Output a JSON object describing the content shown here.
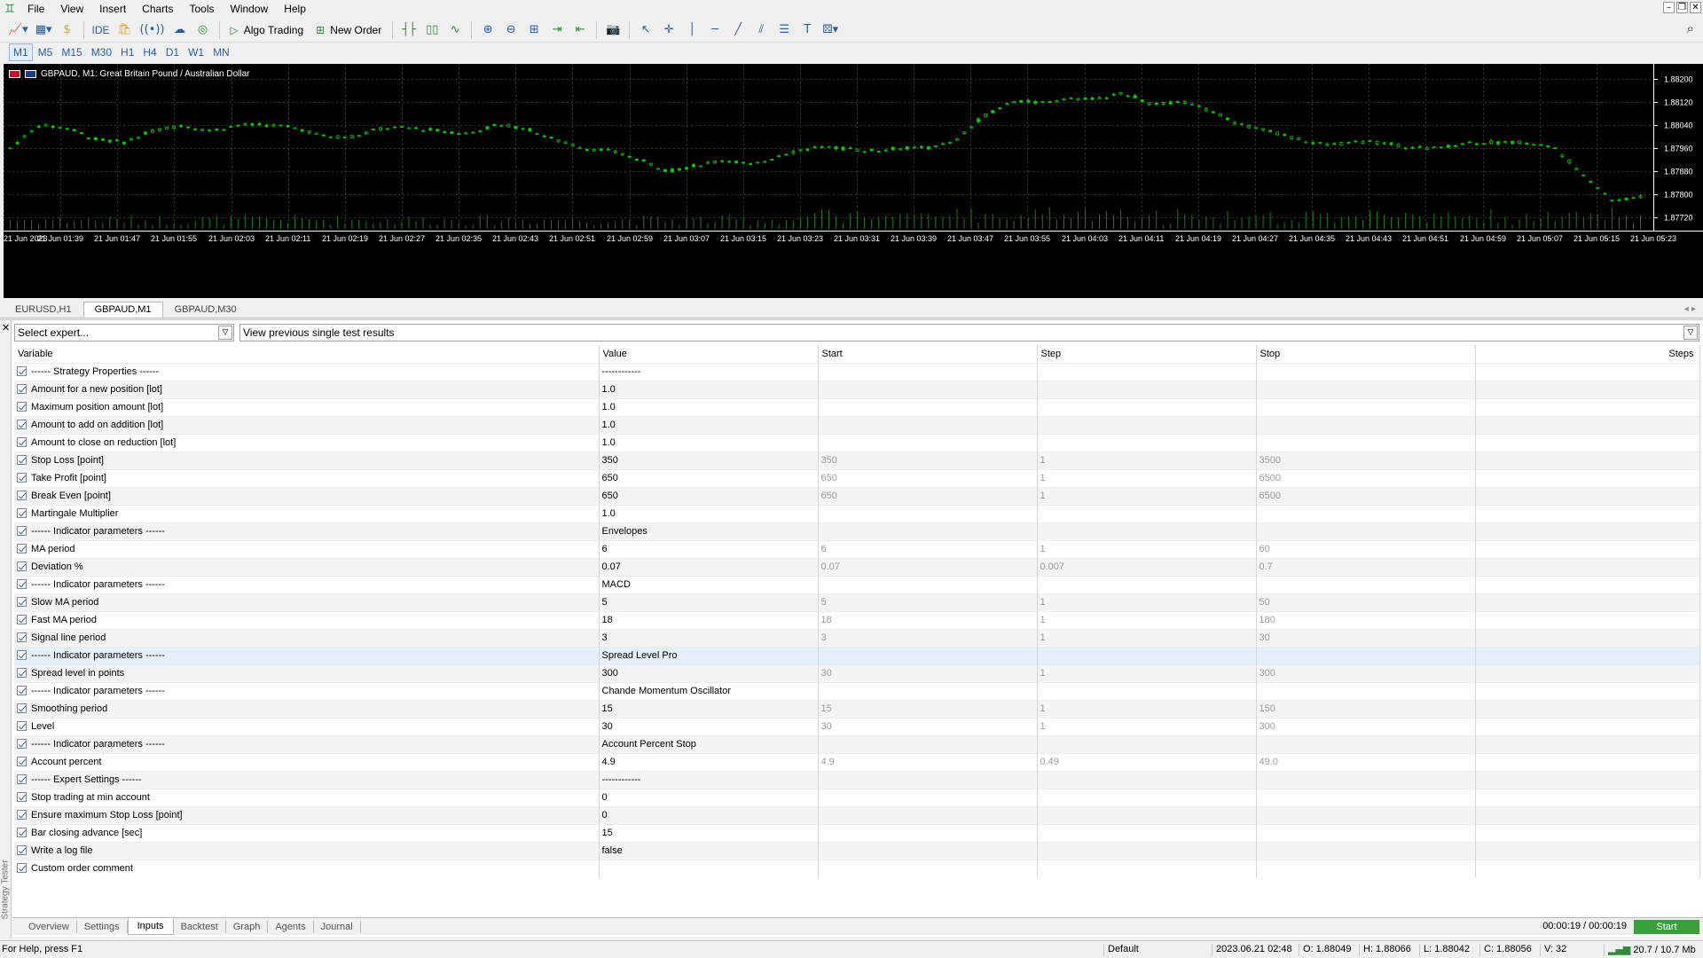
{
  "menu": [
    "File",
    "View",
    "Insert",
    "Charts",
    "Tools",
    "Window",
    "Help"
  ],
  "toolbar": {
    "algo_trading": "Algo Trading",
    "new_order": "New Order",
    "ide": "IDE"
  },
  "timeframes": [
    "M1",
    "M5",
    "M15",
    "M30",
    "H1",
    "H4",
    "D1",
    "W1",
    "MN"
  ],
  "active_timeframe": "M1",
  "chart": {
    "title": "GBPAUD, M1:  Great Britain Pound / Australian Dollar",
    "price_labels": [
      "1.88200",
      "1.88120",
      "1.88040",
      "1.87960",
      "1.87880",
      "1.87800",
      "1.87720"
    ],
    "time_labels": [
      "21 Jun 2023",
      "21 Jun 01:39",
      "21 Jun 01:47",
      "21 Jun 01:55",
      "21 Jun 02:03",
      "21 Jun 02:11",
      "21 Jun 02:19",
      "21 Jun 02:27",
      "21 Jun 02:35",
      "21 Jun 02:43",
      "21 Jun 02:51",
      "21 Jun 02:59",
      "21 Jun 03:07",
      "21 Jun 03:15",
      "21 Jun 03:23",
      "21 Jun 03:31",
      "21 Jun 03:39",
      "21 Jun 03:47",
      "21 Jun 03:55",
      "21 Jun 04:03",
      "21 Jun 04:11",
      "21 Jun 04:19",
      "21 Jun 04:27",
      "21 Jun 04:35",
      "21 Jun 04:43",
      "21 Jun 04:51",
      "21 Jun 04:59",
      "21 Jun 05:07",
      "21 Jun 05:15",
      "21 Jun 05:23"
    ],
    "bull_color": "#00d000",
    "bg_color": "#000000"
  },
  "chart_tabs": [
    "EURUSD,H1",
    "GBPAUD,M1",
    "GBPAUD,M30"
  ],
  "active_chart_tab": "GBPAUD,M1",
  "tester": {
    "expert_placeholder": "Select expert...",
    "view_results": "View previous single test results",
    "side_label": "Strategy Tester",
    "columns": [
      "Variable",
      "Value",
      "Start",
      "Step",
      "Stop",
      "Steps"
    ],
    "rows": [
      {
        "variable": "------ Strategy Properties ------",
        "value": "------------",
        "start": "",
        "step": "",
        "stop": ""
      },
      {
        "variable": "Amount for a new position [lot]",
        "value": "1.0",
        "start": "",
        "step": "",
        "stop": ""
      },
      {
        "variable": "Maximum position amount [lot]",
        "value": "1.0",
        "start": "",
        "step": "",
        "stop": ""
      },
      {
        "variable": "Amount to add on addition [lot]",
        "value": "1.0",
        "start": "",
        "step": "",
        "stop": ""
      },
      {
        "variable": "Amount to close on reduction [lot]",
        "value": "1.0",
        "start": "",
        "step": "",
        "stop": ""
      },
      {
        "variable": "Stop Loss [point]",
        "value": "350",
        "start": "350",
        "step": "1",
        "stop": "3500"
      },
      {
        "variable": "Take Profit [point]",
        "value": "650",
        "start": "650",
        "step": "1",
        "stop": "6500"
      },
      {
        "variable": "Break Even [point]",
        "value": "650",
        "start": "650",
        "step": "1",
        "stop": "6500"
      },
      {
        "variable": "Martingale Multiplier",
        "value": "1.0",
        "start": "",
        "step": "",
        "stop": ""
      },
      {
        "variable": "------ Indicator parameters ------",
        "value": "Envelopes",
        "start": "",
        "step": "",
        "stop": ""
      },
      {
        "variable": "MA period",
        "value": "6",
        "start": "6",
        "step": "1",
        "stop": "60"
      },
      {
        "variable": "Deviation %",
        "value": "0.07",
        "start": "0.07",
        "step": "0.007",
        "stop": "0.7"
      },
      {
        "variable": "------ Indicator parameters ------",
        "value": "MACD",
        "start": "",
        "step": "",
        "stop": ""
      },
      {
        "variable": "Slow MA period",
        "value": "5",
        "start": "5",
        "step": "1",
        "stop": "50"
      },
      {
        "variable": "Fast MA period",
        "value": "18",
        "start": "18",
        "step": "1",
        "stop": "180"
      },
      {
        "variable": "Signal line period",
        "value": "3",
        "start": "3",
        "step": "1",
        "stop": "30"
      },
      {
        "variable": "------ Indicator parameters ------",
        "value": "Spread Level Pro",
        "start": "",
        "step": "",
        "stop": "",
        "selected": true
      },
      {
        "variable": "Spread level in points",
        "value": "300",
        "start": "30",
        "step": "1",
        "stop": "300"
      },
      {
        "variable": "------ Indicator parameters ------",
        "value": "Chande Momentum Oscillator",
        "start": "",
        "step": "",
        "stop": ""
      },
      {
        "variable": "Smoothing period",
        "value": "15",
        "start": "15",
        "step": "1",
        "stop": "150"
      },
      {
        "variable": "Level",
        "value": "30",
        "start": "30",
        "step": "1",
        "stop": "300"
      },
      {
        "variable": "------ Indicator parameters ------",
        "value": "Account Percent Stop",
        "start": "",
        "step": "",
        "stop": ""
      },
      {
        "variable": "Account percent",
        "value": "4.9",
        "start": "4.9",
        "step": "0.49",
        "stop": "49.0"
      },
      {
        "variable": "------ Expert Settings ------",
        "value": "------------",
        "start": "",
        "step": "",
        "stop": ""
      },
      {
        "variable": "Stop trading at min account",
        "value": "0",
        "start": "",
        "step": "",
        "stop": ""
      },
      {
        "variable": "Ensure maximum Stop Loss [point]",
        "value": "0",
        "start": "",
        "step": "",
        "stop": ""
      },
      {
        "variable": "Bar closing advance [sec]",
        "value": "15",
        "start": "",
        "step": "",
        "stop": ""
      },
      {
        "variable": "Write a log file",
        "value": "false",
        "start": "",
        "step": "",
        "stop": ""
      },
      {
        "variable": "Custom order comment",
        "value": "",
        "start": "",
        "step": "",
        "stop": ""
      }
    ],
    "bottom_tabs": [
      "Overview",
      "Settings",
      "Inputs",
      "Backtest",
      "Graph",
      "Agents",
      "Journal"
    ],
    "active_bottom_tab": "Inputs",
    "timer": "00:00:19 / 00:00:19",
    "start_label": "Start",
    "start_color": "#3aa03a"
  },
  "status": {
    "help": "For Help, press F1",
    "profile": "Default",
    "datetime": "2023.06.21 02:48",
    "open": "O: 1.88049",
    "high": "H: 1.88066",
    "low": "L: 1.88042",
    "close": "C: 1.88056",
    "volume": "V: 32",
    "traffic": "20.7 / 10.7 Mb"
  }
}
